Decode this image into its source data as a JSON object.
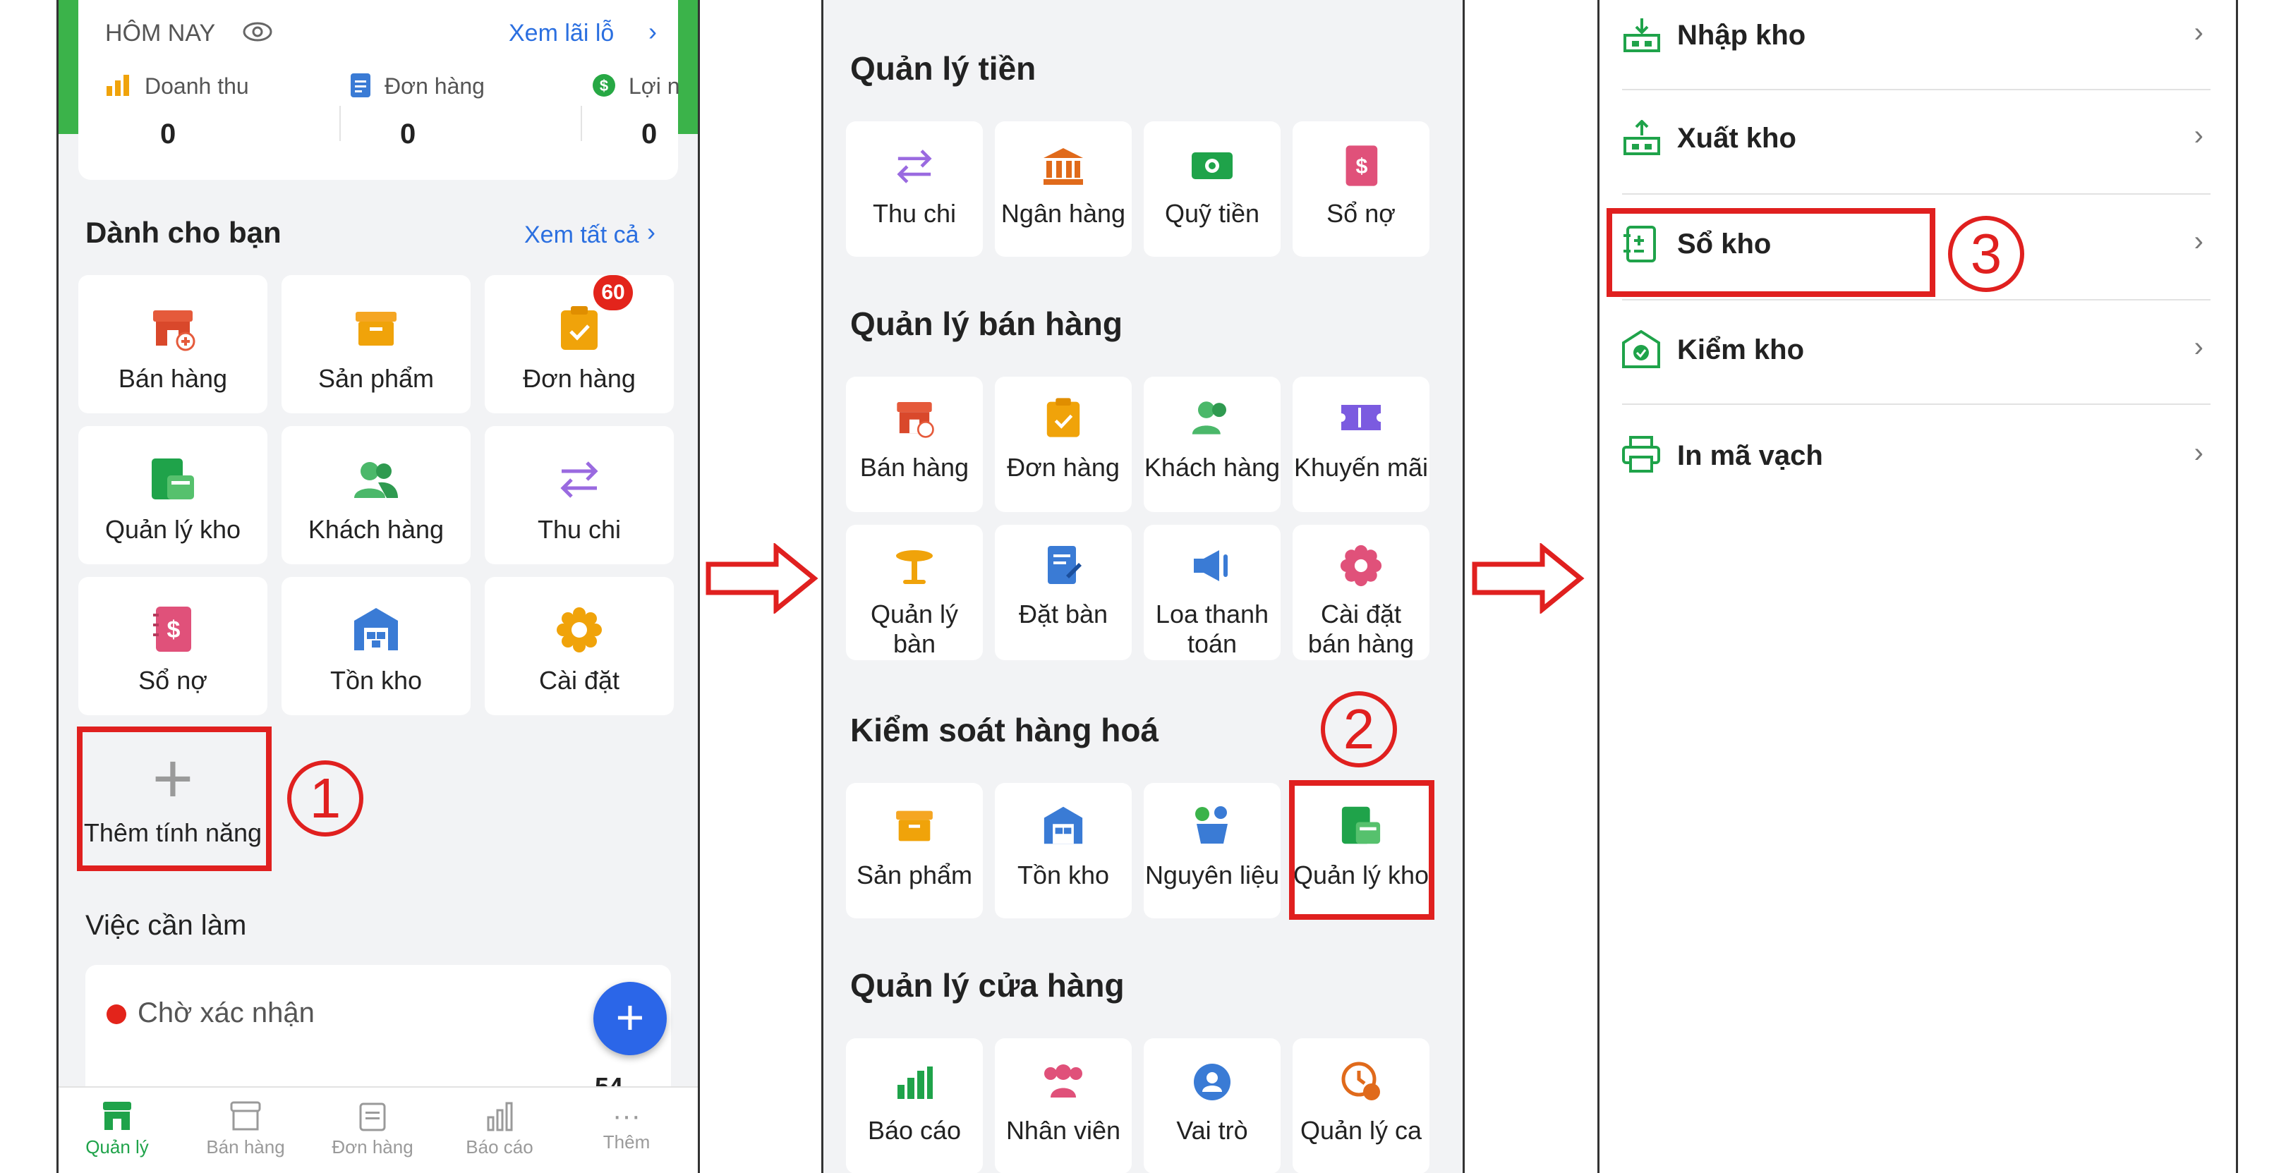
{
  "panel1": {
    "today": {
      "title": "HÔM NAY",
      "link": "Xem lãi lỗ",
      "stats": [
        {
          "label": "Doanh thu",
          "value": "0",
          "icon": "revenue-chart-icon",
          "color": "#f0a30a"
        },
        {
          "label": "Đơn hàng",
          "value": "0",
          "icon": "order-doc-icon",
          "color": "#3a7bd5"
        },
        {
          "label": "Lợi n",
          "value": "0",
          "icon": "profit-dollar-icon",
          "color": "#27a844"
        }
      ]
    },
    "for_you": {
      "title": "Dành cho bạn",
      "link": "Xem tất cả",
      "tiles": [
        {
          "label": "Bán hàng",
          "icon": "store-icon"
        },
        {
          "label": "Sản phẩm",
          "icon": "product-box-icon"
        },
        {
          "label": "Đơn hàng",
          "icon": "clipboard-check-icon",
          "badge": "60"
        },
        {
          "label": "Quản lý kho",
          "icon": "warehouse-manage-icon"
        },
        {
          "label": "Khách hàng",
          "icon": "customers-icon"
        },
        {
          "label": "Thu chi",
          "icon": "transfer-arrows-icon"
        },
        {
          "label": "Sổ nợ",
          "icon": "debt-book-icon"
        },
        {
          "label": "Tồn kho",
          "icon": "inventory-house-icon"
        },
        {
          "label": "Cài đặt",
          "icon": "settings-gear-icon"
        }
      ],
      "add_label": "Thêm tính năng"
    },
    "todo": {
      "title": "Việc cần làm",
      "item": "Chờ xác nhận",
      "partial_count": "54"
    },
    "bottom_nav": [
      "Quản lý",
      "Bán hàng",
      "Đơn hàng",
      "Báo cáo",
      "Thêm"
    ],
    "step": "1"
  },
  "panel2": {
    "sections": [
      {
        "title": "Quản lý tiền",
        "tiles": [
          {
            "label": "Thu chi",
            "icon": "transfer-arrows-icon"
          },
          {
            "label": "Ngân hàng",
            "icon": "bank-icon"
          },
          {
            "label": "Quỹ tiền",
            "icon": "cash-icon"
          },
          {
            "label": "Sổ nợ",
            "icon": "debt-book-icon"
          }
        ]
      },
      {
        "title": "Quản lý bán hàng",
        "tiles": [
          {
            "label": "Bán hàng",
            "icon": "store-icon"
          },
          {
            "label": "Đơn hàng",
            "icon": "clipboard-check-icon"
          },
          {
            "label": "Khách hàng",
            "icon": "customers-icon"
          },
          {
            "label": "Khuyến mãi",
            "icon": "ticket-icon"
          },
          {
            "label": "Quản lý bàn",
            "icon": "table-icon"
          },
          {
            "label": "Đặt bàn",
            "icon": "reserve-doc-icon"
          },
          {
            "label": "Loa thanh toán",
            "icon": "speaker-icon"
          },
          {
            "label": "Cài đặt bán hàng",
            "icon": "flower-gear-icon"
          }
        ]
      },
      {
        "title": "Kiểm soát hàng hoá",
        "tiles": [
          {
            "label": "Sản phẩm",
            "icon": "product-box-icon"
          },
          {
            "label": "Tồn kho",
            "icon": "inventory-house-icon"
          },
          {
            "label": "Nguyên liệu",
            "icon": "ingredients-icon"
          },
          {
            "label": "Quản lý kho",
            "icon": "warehouse-manage-icon"
          }
        ]
      },
      {
        "title": "Quản lý cửa hàng",
        "tiles": [
          {
            "label": "Báo cáo",
            "icon": "report-chart-icon"
          },
          {
            "label": "Nhân viên",
            "icon": "staff-icon"
          },
          {
            "label": "Vai trò",
            "icon": "role-badge-icon"
          },
          {
            "label": "Quản lý ca",
            "icon": "shift-icon"
          }
        ]
      }
    ],
    "step": "2"
  },
  "panel3": {
    "items": [
      {
        "label": "Nhập kho",
        "icon": "import-warehouse-icon"
      },
      {
        "label": "Xuất kho",
        "icon": "export-warehouse-icon"
      },
      {
        "label": "Sổ kho",
        "icon": "stock-ledger-icon"
      },
      {
        "label": "Kiểm kho",
        "icon": "stock-check-icon"
      },
      {
        "label": "In mã vạch",
        "icon": "printer-icon"
      }
    ],
    "step": "3"
  },
  "colors": {
    "accent_green": "#1fa34a",
    "link_blue": "#2b6fe0",
    "highlight_red": "#e0201f"
  }
}
